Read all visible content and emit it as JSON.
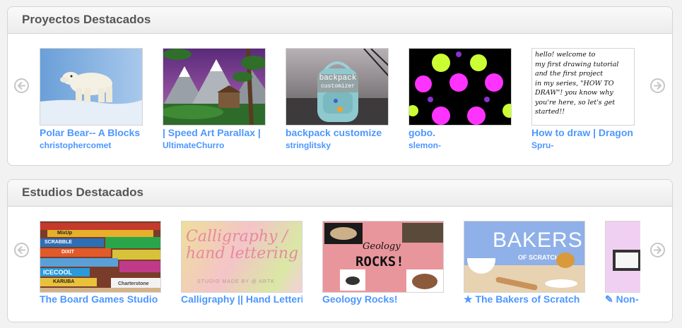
{
  "projects": {
    "heading": "Proyectos Destacados",
    "items": [
      {
        "title": "Polar Bear-- A Blocks",
        "author": "christophercomet"
      },
      {
        "title": "| Speed Art Parallax |",
        "author": "UltimateChurro"
      },
      {
        "title": "backpack customize",
        "author": "stringlitsky"
      },
      {
        "title": "gobo.",
        "author": "slemon-"
      },
      {
        "title": "How to draw | Dragon",
        "author": "Spru-"
      }
    ],
    "thumb_text": {
      "backpack": "backpack",
      "customizer": "customizer",
      "howto": [
        "hello! welcome to",
        "my first drawing tutorial",
        "and the first project",
        "in my series, \"HOW TO",
        "DRAW\"!  you know why",
        "you're here, so let's get",
        "started!!"
      ]
    }
  },
  "studios": {
    "heading": "Estudios Destacados",
    "items": [
      {
        "title": "The Board Games Studio",
        "icon": ""
      },
      {
        "title": "Calligraphy || Hand Lettering",
        "icon": ""
      },
      {
        "title": "Geology Rocks!",
        "icon": ""
      },
      {
        "title": "The Bakers of Scratch",
        "icon": "star-icon"
      },
      {
        "title": "Non-",
        "icon": "pencil-icon"
      }
    ],
    "thumb_text": {
      "calligraphy": [
        "Calligraphy /",
        "hand lettering"
      ],
      "calligraphy_small": "STUDIO MADE BY @ ARTK",
      "geology": "Geology",
      "rocks": "ROCKS!",
      "bakers": "BAKERS",
      "of_scratch": "OF SCRATCH",
      "games": [
        "SCRABBLE",
        "DIXIT",
        "ICECOOL",
        "KARUBA",
        "MixUp",
        "Charterstone"
      ]
    }
  },
  "colors": {
    "link": "#4d97ff",
    "heading": "#555555",
    "border": "#d4d4d4"
  }
}
